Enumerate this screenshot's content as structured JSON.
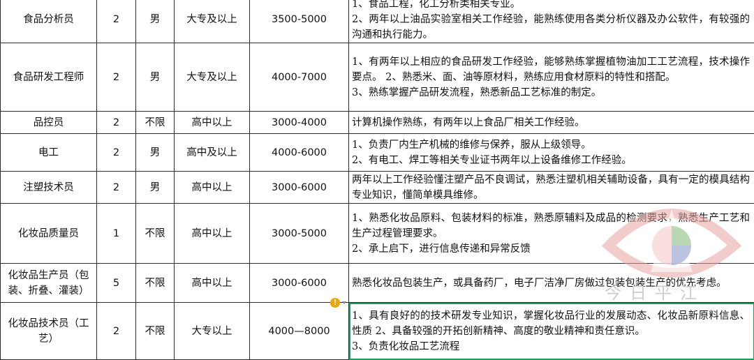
{
  "rows": [
    {
      "title": "食品分析员",
      "count": "2",
      "gender": "男",
      "edu": "大专及以上",
      "salary": "3500-5000",
      "req": [
        "1、食品工程，化工分析类相关专业。",
        "2、两年以上油品实验室相关工作经验，能熟练使用各类分析仪器及办公软件，有较强的沟通和执行能力。"
      ]
    },
    {
      "title": "食品研发工程师",
      "count": "2",
      "gender": "男",
      "edu": "大专及以上",
      "salary": "4000-7000",
      "req": [
        "1、有两年以上相应的食品研发工作经验，能够熟练掌握植物油加工工艺流程，技术操作要点。                2、熟悉米、面、油等原材料，熟练应用食材原料的特性和搭配。",
        "3、熟练掌握产品研发流程，熟悉新品工艺标准的制定。"
      ]
    },
    {
      "title": "品控员",
      "count": "2",
      "gender": "不限",
      "edu": "高中以上",
      "salary": "3000-4000",
      "req": [
        "计算机操作熟练，有两年以上食品厂相关工作经验。"
      ]
    },
    {
      "title": "电工",
      "count": "2",
      "gender": "男",
      "edu": "高中及以上",
      "salary": "4000-6000",
      "req": [
        "1、负责厂内生产机械的维修与保养，服从上级领导。",
        "2、有电工、焊工等相关专业证书两年以上设备维修工作经验。"
      ]
    },
    {
      "title": "注塑技术员",
      "count": "2",
      "gender": "男",
      "edu": "高中以上",
      "salary": "3000-6000",
      "req": [
        "两年以上工作经验懂注塑产品不良调试，熟悉注塑机相关辅助设备，具有一定的模具结构专业知识，懂简单模具维修。"
      ]
    },
    {
      "title": "化妆品质量员",
      "count": "1",
      "gender": "不限",
      "edu": "高中以上",
      "salary": "3000-5000",
      "req": [
        "1、熟悉化妆品原料、包装材料的标准，熟悉原辅料及成品的检测要求，熟悉生产工艺和生产过程管理要求。",
        "2、承上启下，进行信息传递和异常反馈"
      ]
    },
    {
      "title": "化妆品生产员（包装、折叠、灌装）",
      "count": "5",
      "gender": "不限",
      "edu": "高中以上",
      "salary": "3000-6000",
      "req": [
        "熟悉化妆品包装生产，或具备药厂，电子厂洁净厂房做过包装包装生产的优先考虑。"
      ]
    },
    {
      "title": "化妆品技术员（工艺）",
      "count": "2",
      "gender": "不限",
      "edu": "大专以上",
      "salary": "4000—8000",
      "req": [
        "1、具有良好的的技术研发专业知识，掌握化妆品行业的发展动态、化妆品新原料信息、性质     2、具备较强的开拓创新精神、高度的敬业精神和责任意识。",
        "3、负责化妆品工艺流程"
      ]
    }
  ],
  "watermark": {
    "text": "今日平江",
    "icon": "eye-logo-icon"
  },
  "warning_icon": "warning-icon",
  "colors": {
    "grid": "#2b2b2b",
    "selection": "#1f9d55",
    "warning": "#f0a500"
  }
}
